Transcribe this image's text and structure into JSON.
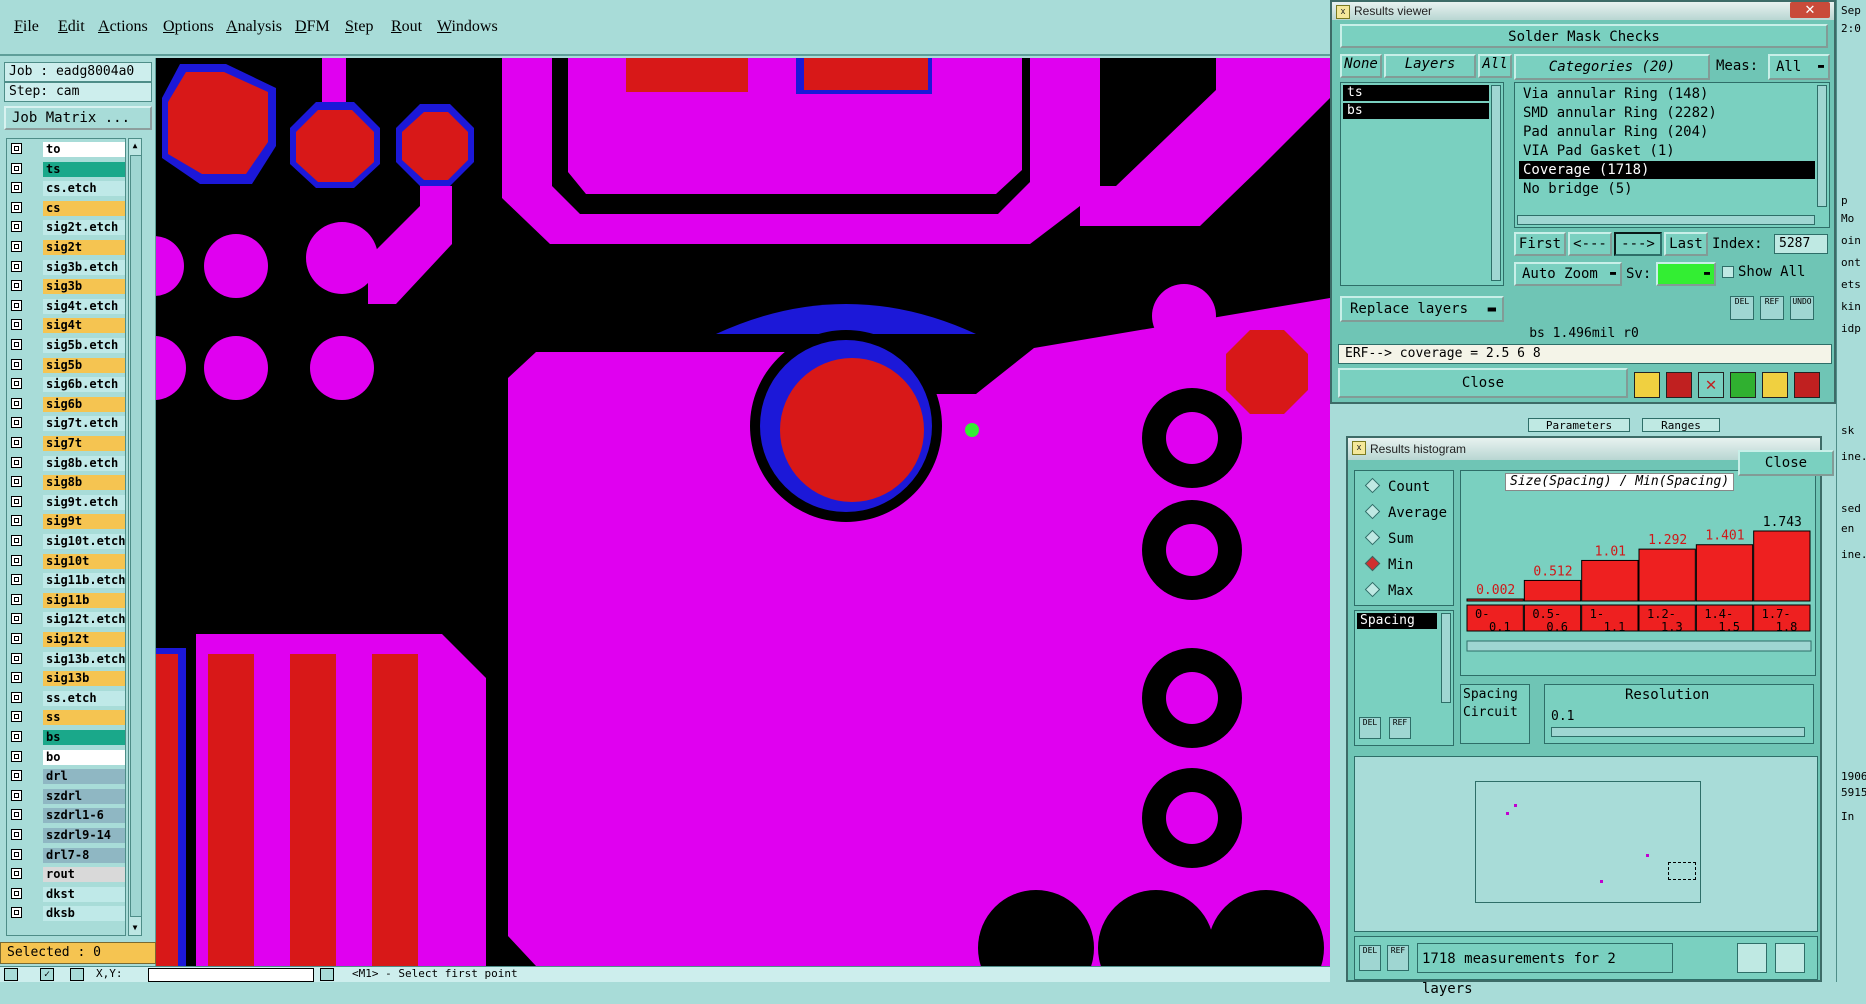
{
  "menu": {
    "items": [
      "File",
      "Edit",
      "Actions",
      "Options",
      "Analysis",
      "DFM",
      "Step",
      "Rout",
      "Windows"
    ]
  },
  "left": {
    "job": "Job : eadg8004a0",
    "step": "Step: cam",
    "job_matrix": "Job Matrix ...",
    "selected": "Selected : 0",
    "layers": [
      {
        "name": "to",
        "color": "#ffffff"
      },
      {
        "name": "ts",
        "color": "#1aa88a"
      },
      {
        "name": "cs.etch",
        "color": "#bfe9e8"
      },
      {
        "name": "cs",
        "color": "#f5c451"
      },
      {
        "name": "sig2t.etch",
        "color": "#bfe9e8"
      },
      {
        "name": "sig2t",
        "color": "#f5c451"
      },
      {
        "name": "sig3b.etch",
        "color": "#bfe9e8"
      },
      {
        "name": "sig3b",
        "color": "#f5c451"
      },
      {
        "name": "sig4t.etch",
        "color": "#bfe9e8"
      },
      {
        "name": "sig4t",
        "color": "#f5c451"
      },
      {
        "name": "sig5b.etch",
        "color": "#bfe9e8"
      },
      {
        "name": "sig5b",
        "color": "#f5c451"
      },
      {
        "name": "sig6b.etch",
        "color": "#bfe9e8"
      },
      {
        "name": "sig6b",
        "color": "#f5c451"
      },
      {
        "name": "sig7t.etch",
        "color": "#bfe9e8"
      },
      {
        "name": "sig7t",
        "color": "#f5c451"
      },
      {
        "name": "sig8b.etch",
        "color": "#bfe9e8"
      },
      {
        "name": "sig8b",
        "color": "#f5c451"
      },
      {
        "name": "sig9t.etch",
        "color": "#bfe9e8"
      },
      {
        "name": "sig9t",
        "color": "#f5c451"
      },
      {
        "name": "sig10t.etch",
        "color": "#bfe9e8"
      },
      {
        "name": "sig10t",
        "color": "#f5c451"
      },
      {
        "name": "sig11b.etch",
        "color": "#bfe9e8"
      },
      {
        "name": "sig11b",
        "color": "#f5c451"
      },
      {
        "name": "sig12t.etch",
        "color": "#bfe9e8"
      },
      {
        "name": "sig12t",
        "color": "#f5c451"
      },
      {
        "name": "sig13b.etch",
        "color": "#bfe9e8"
      },
      {
        "name": "sig13b",
        "color": "#f5c451"
      },
      {
        "name": "ss.etch",
        "color": "#bfe9e8"
      },
      {
        "name": "ss",
        "color": "#f5c451"
      },
      {
        "name": "bs",
        "color": "#1aa88a"
      },
      {
        "name": "bo",
        "color": "#ffffff"
      },
      {
        "name": "drl",
        "color": "#8fb7c3"
      },
      {
        "name": "szdrl",
        "color": "#8fb7c3"
      },
      {
        "name": "szdrl1-6",
        "color": "#8fb7c3"
      },
      {
        "name": "szdrl9-14",
        "color": "#8fb7c3"
      },
      {
        "name": "drl7-8",
        "color": "#8fb7c3"
      },
      {
        "name": "rout",
        "color": "#d9d9d9"
      },
      {
        "name": "dkst",
        "color": "#bfe9e8"
      },
      {
        "name": "dksb",
        "color": "#bfe9e8"
      }
    ]
  },
  "bottom": {
    "xy_label": "X,Y:",
    "status": "<M1> - Select first point"
  },
  "results_viewer": {
    "title": "Results viewer",
    "header": "Solder Mask Checks",
    "none": "None",
    "layers": "Layers",
    "all": "All",
    "categories_header": "Categories (20)",
    "meas_label": "Meas:",
    "meas_value": "All",
    "layer_items": [
      "ts",
      "bs"
    ],
    "categories": [
      "Via annular Ring (148)",
      "SMD annular Ring (2282)",
      "Pad annular Ring (204)",
      "VIA Pad Gasket (1)",
      "Coverage (1718)",
      "No bridge (5)"
    ],
    "selected_category": 4,
    "first": "First",
    "prev": "<---",
    "next": "--->",
    "last": "Last",
    "index_label": "Index:",
    "index_value": "5287",
    "auto_zoom": "Auto Zoom",
    "sv_label": "Sv:",
    "show_all": "Show All",
    "replace_layers": "Replace layers",
    "info_line": "bs 1.496mil  r0",
    "erf_line": "ERF--> coverage = 2.5 6 8",
    "close": "Close"
  },
  "histogram": {
    "title": "Results histogram",
    "options": [
      "Count",
      "Average",
      "Sum",
      "Min",
      "Max"
    ],
    "selected_option": "Min",
    "list_item": "Spacing",
    "chart_title": "Size(Spacing) / Min(Spacing)",
    "resolution_label": "Resolution",
    "resolution_value": "0.1",
    "dd_items": [
      "Spacing",
      "Circuit"
    ],
    "footer": "1718 measurements for 2 layers",
    "del": "DEL",
    "ref": "REF"
  },
  "chart_data": {
    "type": "bar",
    "title": "Size(Spacing) / Min(Spacing)",
    "categories": [
      "0-0.1",
      "0.5-0.6",
      "1-1.1",
      "1.2-1.3",
      "1.4-1.5",
      "1.7-1.8"
    ],
    "values": [
      0.002,
      0.512,
      1.01,
      1.292,
      1.401,
      1.743
    ],
    "value_labels": [
      "0.002",
      "0.512",
      "1.01",
      "1.292",
      "1.401",
      "1.743"
    ],
    "ylim": [
      0,
      1.743
    ],
    "bar_color": "#ee2020",
    "label_color": "#d01818"
  },
  "right_strip": {
    "labels": [
      "Sep",
      "2:0",
      "p",
      "Mo",
      "oin",
      "ont",
      "ets",
      "kin",
      "idp",
      "sk",
      "ine...",
      "sed",
      "en",
      "ine...",
      "1906",
      "5915",
      "In"
    ],
    "params": "Parameters",
    "ranges": "Ranges",
    "close": "Close"
  },
  "colors": {
    "pad_red": "#d81818",
    "copper_magenta": "#e000f0",
    "mask_blue": "#1c18d8",
    "accent_green": "#33ee33"
  }
}
